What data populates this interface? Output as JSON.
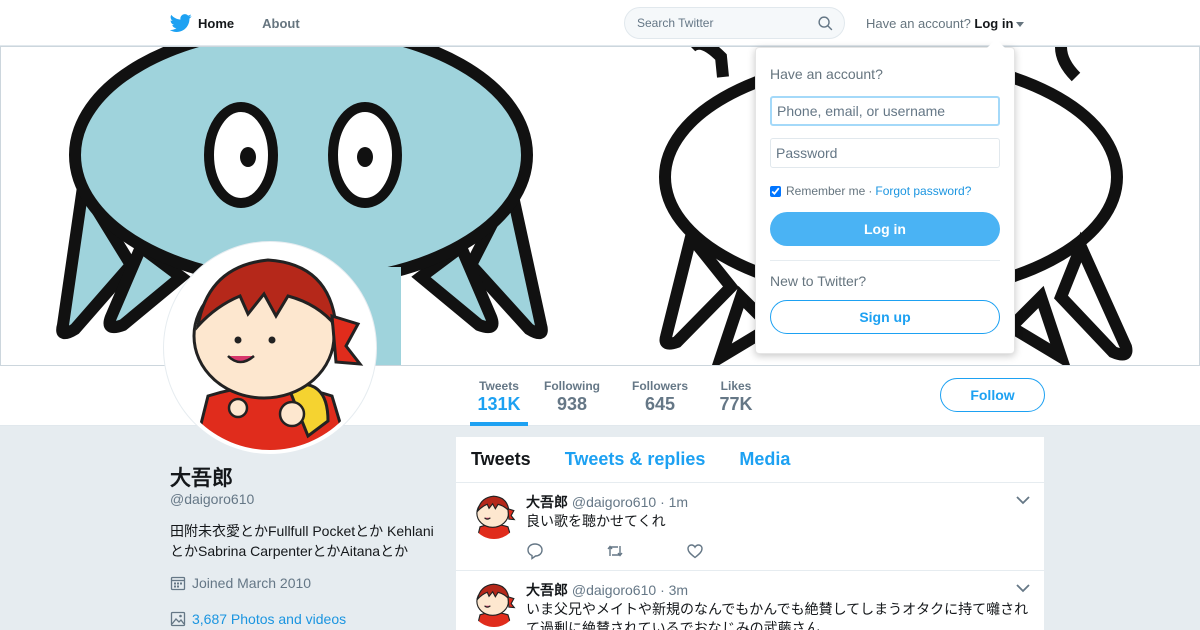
{
  "nav": {
    "home_label": "Home",
    "about_label": "About",
    "search_placeholder": "Search Twitter",
    "have_account": "Have an account?",
    "login_label": "Log in"
  },
  "profile_nav": {
    "stats": [
      {
        "label": "Tweets",
        "value": "131K"
      },
      {
        "label": "Following",
        "value": "938"
      },
      {
        "label": "Followers",
        "value": "645"
      },
      {
        "label": "Likes",
        "value": "77K"
      }
    ],
    "follow_label": "Follow"
  },
  "profile": {
    "name": "大吾郎",
    "handle": "@daigoro610",
    "bio_line1": "田附未衣愛とかFullfull Pocketとか Kehlani",
    "bio_line2": "とかSabrina CarpenterとかAitanaとか",
    "joined": "Joined March 2010",
    "photos": "3,687 Photos and videos"
  },
  "timeline": {
    "tabs": [
      "Tweets",
      "Tweets & replies",
      "Media"
    ],
    "tweets": [
      {
        "name": "大吾郎",
        "handle": "@daigoro610",
        "dot": "·",
        "time": "1m",
        "text": "良い歌を聴かせてくれ"
      },
      {
        "name": "大吾郎",
        "handle": "@daigoro610",
        "dot": "·",
        "time": "3m",
        "text": "いま父兄やメイトや新規のなんでもかんでも絶賛してしまうオタクに持て囃されて過剰に絶賛されているでおなじみの武藤さん"
      }
    ]
  },
  "login_dropdown": {
    "title": "Have an account?",
    "username_placeholder": "Phone, email, or username",
    "password_placeholder": "Password",
    "remember": "Remember me",
    "separator": "·",
    "forgot": "Forgot password?",
    "login_button": "Log in",
    "new_to": "New to Twitter?",
    "signup_button": "Sign up"
  },
  "colors": {
    "brand_blue": "#1da1f2",
    "link_blue": "#1b95e0",
    "login_button": "#4ab3f4",
    "background": "#e6ecf0",
    "muted_text": "#657786"
  },
  "icons": [
    "twitter-bird-icon",
    "search-icon",
    "caret-down-icon",
    "calendar-icon",
    "photo-icon",
    "reply-icon",
    "retweet-icon",
    "like-icon",
    "chevron-down-icon"
  ]
}
